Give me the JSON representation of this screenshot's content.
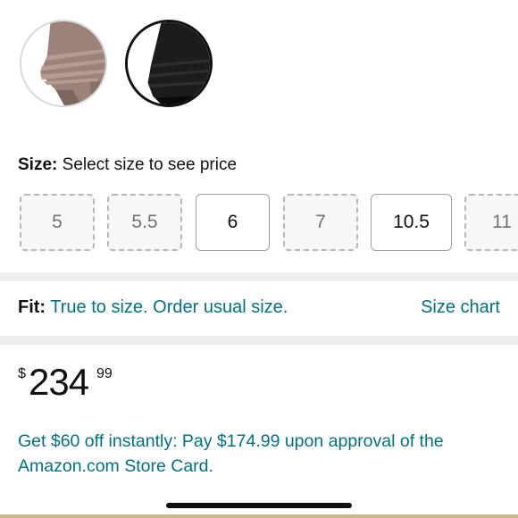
{
  "swatches": [
    {
      "name": "taupe",
      "selected": false
    },
    {
      "name": "black",
      "selected": true
    }
  ],
  "size": {
    "label": "Size:",
    "prompt": "Select size to see price",
    "options": [
      {
        "value": "5",
        "available": false
      },
      {
        "value": "5.5",
        "available": false
      },
      {
        "value": "6",
        "available": true
      },
      {
        "value": "7",
        "available": false
      },
      {
        "value": "10.5",
        "available": true
      },
      {
        "value": "11",
        "available": false
      }
    ]
  },
  "fit": {
    "label": "Fit:",
    "value": "True to size. Order usual size.",
    "size_chart_link": "Size chart"
  },
  "price": {
    "currency": "$",
    "whole": "234",
    "fraction": "99"
  },
  "promo": {
    "text": "Get $60 off instantly: Pay $174.99 upon approval of the Amazon.com Store Card."
  },
  "colors": {
    "link": "#007185",
    "text": "#0f1111",
    "divider": "#eeeeee"
  }
}
